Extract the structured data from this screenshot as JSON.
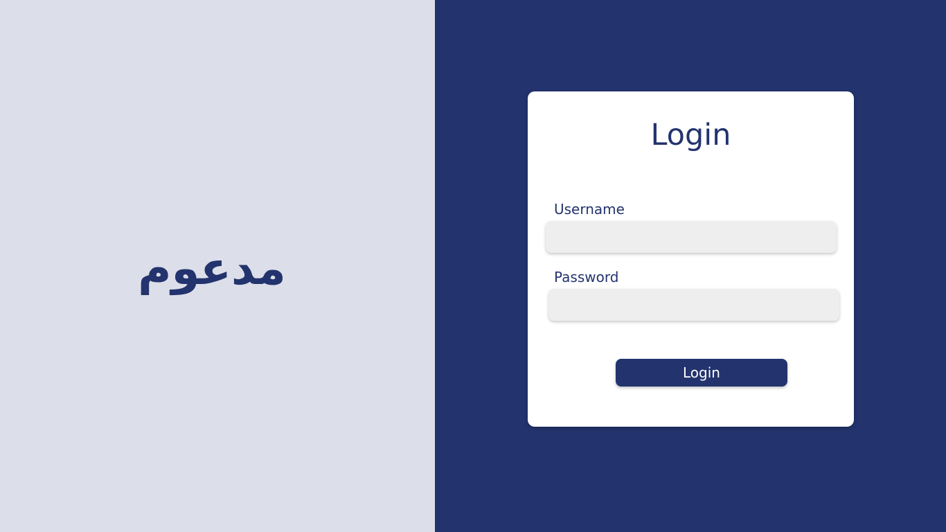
{
  "colors": {
    "left_background": "#dcdfe9",
    "right_background": "#23336d",
    "card_background": "#ffffff",
    "accent": "#23336d",
    "input_background": "#eeeeee"
  },
  "brand": {
    "logo_text": "مدعوم"
  },
  "login_form": {
    "title": "Login",
    "username": {
      "label": "Username",
      "value": "",
      "placeholder": ""
    },
    "password": {
      "label": "Password",
      "value": "",
      "placeholder": ""
    },
    "submit_label": "Login"
  }
}
